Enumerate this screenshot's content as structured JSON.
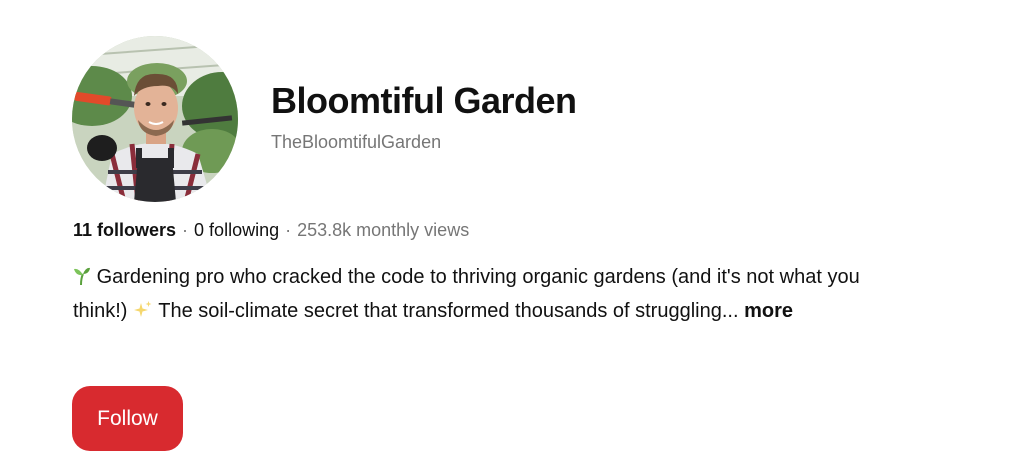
{
  "profile": {
    "name": "Bloomtiful Garden",
    "handle": "TheBloomtifulGarden",
    "avatar_icon": "avatar-gardener-photo",
    "stats": {
      "followers": "11 followers",
      "following": "0 following",
      "monthly_views": "253.8k monthly views",
      "separator": "·"
    },
    "bio": {
      "leading_icon": "sprout-icon",
      "text_part1": "Gardening pro who cracked the code to thriving organic gardens (and it's not what you think!)",
      "mid_icon": "sparkles-icon",
      "text_part2": "The soil-climate secret that transformed thousands of struggling...",
      "more_label": "more"
    },
    "follow_label": "Follow"
  },
  "colors": {
    "follow_button_bg": "#d82a2f",
    "secondary_text": "#767676",
    "primary_text": "#111111"
  }
}
